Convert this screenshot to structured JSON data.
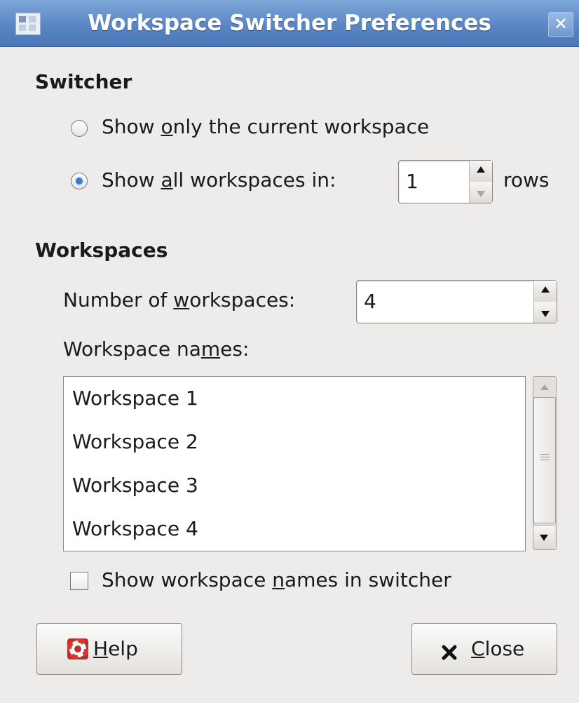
{
  "window": {
    "title": "Workspace Switcher Preferences",
    "icon": "workspace-switcher-icon",
    "close_icon": "close-icon"
  },
  "switcher": {
    "heading": "Switcher",
    "option_current": {
      "pre": "Show ",
      "mnemonic": "o",
      "post": "nly the current workspace",
      "selected": false
    },
    "option_all": {
      "pre": "Show ",
      "mnemonic": "a",
      "post": "ll workspaces in:",
      "selected": true
    },
    "rows_value": "1",
    "rows_suffix": "rows"
  },
  "workspaces": {
    "heading": "Workspaces",
    "number_label": {
      "pre": "Number of ",
      "mnemonic": "w",
      "post": "orkspaces:"
    },
    "number_value": "4",
    "names_label": {
      "pre": "Workspace na",
      "mnemonic": "m",
      "post": "es:"
    },
    "names": [
      "Workspace 1",
      "Workspace 2",
      "Workspace 3",
      "Workspace 4"
    ],
    "show_names": {
      "pre": "Show workspace ",
      "mnemonic": "n",
      "post": "ames in switcher",
      "checked": false
    }
  },
  "buttons": {
    "help": {
      "mnemonic": "H",
      "rest": "elp",
      "icon": "help-lifebuoy-icon"
    },
    "close": {
      "mnemonic": "C",
      "rest": "lose",
      "icon": "close-x-icon"
    }
  }
}
